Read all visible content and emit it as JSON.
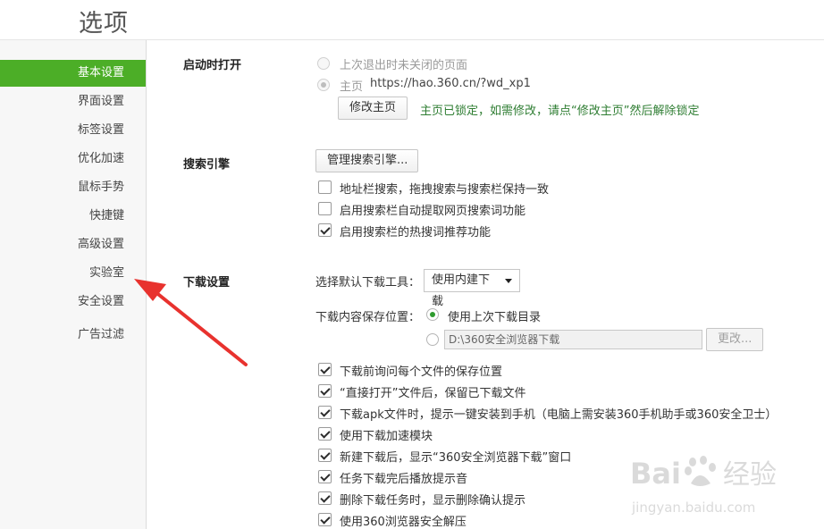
{
  "page": {
    "title": "选项"
  },
  "sidebar": {
    "items": [
      {
        "label": "基本设置",
        "active": true
      },
      {
        "label": "界面设置"
      },
      {
        "label": "标签设置"
      },
      {
        "label": "优化加速"
      },
      {
        "label": "鼠标手势"
      },
      {
        "label": "快捷键"
      },
      {
        "label": "高级设置"
      },
      {
        "label": "实验室"
      },
      {
        "label": "安全设置"
      },
      {
        "label": "广告过滤"
      }
    ]
  },
  "startup": {
    "title": "启动时打开",
    "option_last": "上次退出时未关闭的页面",
    "option_home": "主页",
    "home_url": "https://hao.360.cn/?wd_xp1",
    "change_home_button": "修改主页",
    "locked_note": "主页已锁定，如需修改，请点“修改主页”然后解除锁定"
  },
  "search": {
    "title": "搜索引擎",
    "manage_button": "管理搜索引擎...",
    "options": [
      {
        "label": "地址栏搜索，拖拽搜索与搜索栏保持一致",
        "checked": false
      },
      {
        "label": "启用搜索栏自动提取网页搜索词功能",
        "checked": false
      },
      {
        "label": "启用搜索栏的热搜词推荐功能",
        "checked": true
      }
    ]
  },
  "download": {
    "title": "下载设置",
    "tool_label": "选择默认下载工具：",
    "tool_value": "使用内建下载",
    "save_label": "下载内容保存位置：",
    "save_last": "使用上次下载目录",
    "save_path": "D:\\360安全浏览器下载",
    "change_button": "更改...",
    "options": [
      {
        "label": "下载前询问每个文件的保存位置",
        "checked": true
      },
      {
        "label": "“直接打开”文件后，保留已下载文件",
        "checked": true
      },
      {
        "label": "下载apk文件时，提示一键安装到手机（电脑上需安装360手机助手或360安全卫士）",
        "checked": true
      },
      {
        "label": "使用下载加速模块",
        "checked": true
      },
      {
        "label": "新建下载后，显示“360安全浏览器下载”窗口",
        "checked": true
      },
      {
        "label": "任务下载完后播放提示音",
        "checked": true
      },
      {
        "label": "删除下载任务时，显示删除确认提示",
        "checked": true
      },
      {
        "label": "使用360浏览器安全解压",
        "checked": true
      }
    ]
  },
  "colors": {
    "accent": "#4cae27",
    "annotation_arrow": "#e8322e"
  },
  "watermark": {
    "brand": "Baidu经验",
    "url": "jingyan.baidu.com"
  }
}
